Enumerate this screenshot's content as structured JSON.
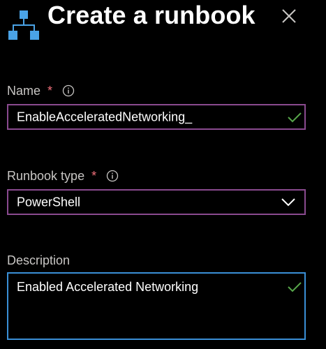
{
  "panel": {
    "title": "Create a runbook"
  },
  "form": {
    "name": {
      "label": "Name",
      "required_mark": "*",
      "value": "EnableAcceleratedNetworking_"
    },
    "runbook_type": {
      "label": "Runbook type",
      "required_mark": "*",
      "selected": "PowerShell"
    },
    "description": {
      "label": "Description",
      "value": "Enabled Accelerated Networking"
    }
  },
  "icons": {
    "header": "runbook-hierarchy-icon",
    "close": "close-icon",
    "info": "info-icon",
    "valid": "checkmark-icon",
    "dropdown": "chevron-down-icon"
  },
  "colors": {
    "background": "#000000",
    "icon_blue": "#4aa3e6",
    "input_border": "#8a4a8f",
    "focus_border": "#3a8fd6",
    "valid_check": "#57a64a",
    "required_star": "#f1707b",
    "label_text": "#c8c6c4"
  }
}
